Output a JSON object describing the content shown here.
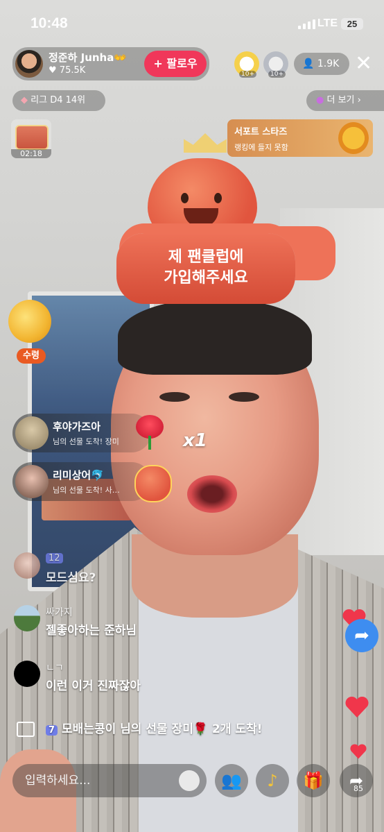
{
  "status_bar": {
    "time": "10:48",
    "network": "LTE",
    "battery": "25"
  },
  "host": {
    "name": "정준하 Junha👐",
    "likes": "75.5K",
    "follow_label": "팔로우"
  },
  "top_ranks": [
    {
      "level": "10+"
    },
    {
      "level": "10+"
    }
  ],
  "viewers": "1.9K",
  "league": "리그 D4 14위",
  "more_label": "더 보기",
  "chest_timer": "02:18",
  "support_stars": {
    "title": "서포트 스타즈",
    "subtitle": "랭킹에 들지 못함"
  },
  "fanclub_banner": {
    "line1": "제 팬클럽에",
    "line2": "가입해주세요"
  },
  "claim_label": "수령",
  "gift_banners": [
    {
      "name": "후야가즈아",
      "text": "님의 선물 도착! 장미"
    },
    {
      "name": "리미상어🐬",
      "text": "님의 선물 도착! 사…"
    }
  ],
  "combo": "x1",
  "chat": [
    {
      "name": "12 ...",
      "level": "12",
      "message": "모드심요?"
    },
    {
      "name": "싸가지",
      "message": "젤좋아하는 준하님"
    },
    {
      "name": "ㄴㄱ",
      "message": "이런 이거 진짜잖아"
    }
  ],
  "system_message": {
    "level": "7",
    "text": "모배는콩이 님의 선물 장미🌹 2개 도착!"
  },
  "input_placeholder": "입력하세요...",
  "share_count": "85",
  "colors": {
    "follow": "#f0375a",
    "share": "#3e8df0",
    "claim": "#e95a22",
    "heart": "#f0364b"
  }
}
